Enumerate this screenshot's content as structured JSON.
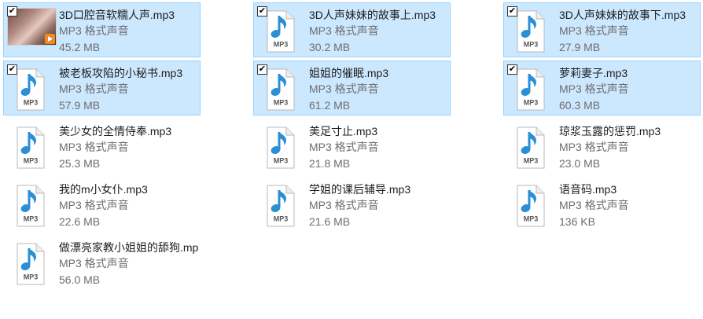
{
  "files": [
    {
      "name": "3D口腔音软糯人声.mp3",
      "type": "MP3 格式声音",
      "size": "45.2 MB",
      "checked": true,
      "thumbnail": "video-thumbnail",
      "icon": "mp3-file-icon"
    },
    {
      "name": "3D人声妹妹的故事上.mp3",
      "type": "MP3 格式声音",
      "size": "30.2 MB",
      "checked": true,
      "icon": "mp3-file-icon"
    },
    {
      "name": "3D人声妹妹的故事下.mp3",
      "type": "MP3 格式声音",
      "size": "27.9 MB",
      "checked": true,
      "icon": "mp3-file-icon"
    },
    {
      "name": "被老板攻陷的小秘书.mp3",
      "type": "MP3 格式声音",
      "size": "57.9 MB",
      "checked": true,
      "icon": "mp3-file-icon"
    },
    {
      "name": "姐姐的催眠.mp3",
      "type": "MP3 格式声音",
      "size": "61.2 MB",
      "checked": true,
      "icon": "mp3-file-icon"
    },
    {
      "name": "萝莉妻子.mp3",
      "type": "MP3 格式声音",
      "size": "60.3 MB",
      "checked": true,
      "icon": "mp3-file-icon"
    },
    {
      "name": "美少女的全情侍奉.mp3",
      "type": "MP3 格式声音",
      "size": "25.3 MB",
      "checked": false,
      "icon": "mp3-file-icon"
    },
    {
      "name": "美足寸止.mp3",
      "type": "MP3 格式声音",
      "size": "21.8 MB",
      "checked": false,
      "icon": "mp3-file-icon"
    },
    {
      "name": "琼浆玉露的惩罚.mp3",
      "type": "MP3 格式声音",
      "size": "23.0 MB",
      "checked": false,
      "icon": "mp3-file-icon"
    },
    {
      "name": "我的m小女仆.mp3",
      "type": "MP3 格式声音",
      "size": "22.6 MB",
      "checked": false,
      "icon": "mp3-file-icon"
    },
    {
      "name": "学姐的课后辅导.mp3",
      "type": "MP3 格式声音",
      "size": "21.6 MB",
      "checked": false,
      "icon": "mp3-file-icon"
    },
    {
      "name": "语音码.mp3",
      "type": "MP3 格式声音",
      "size": "136 KB",
      "checked": false,
      "icon": "mp3-file-icon"
    },
    {
      "name": "做漂亮家教小姐姐的舔狗.mp3",
      "type": "MP3 格式声音",
      "size": "56.0 MB",
      "checked": false,
      "icon": "mp3-file-icon"
    }
  ],
  "icon_label": "MP3",
  "colors": {
    "selection_bg": "#cce8ff",
    "selection_border": "#99d1ff",
    "note_blue": "#2b8fd6",
    "file_text": "#1e1e1e",
    "secondary_text": "#6d6d6d"
  }
}
